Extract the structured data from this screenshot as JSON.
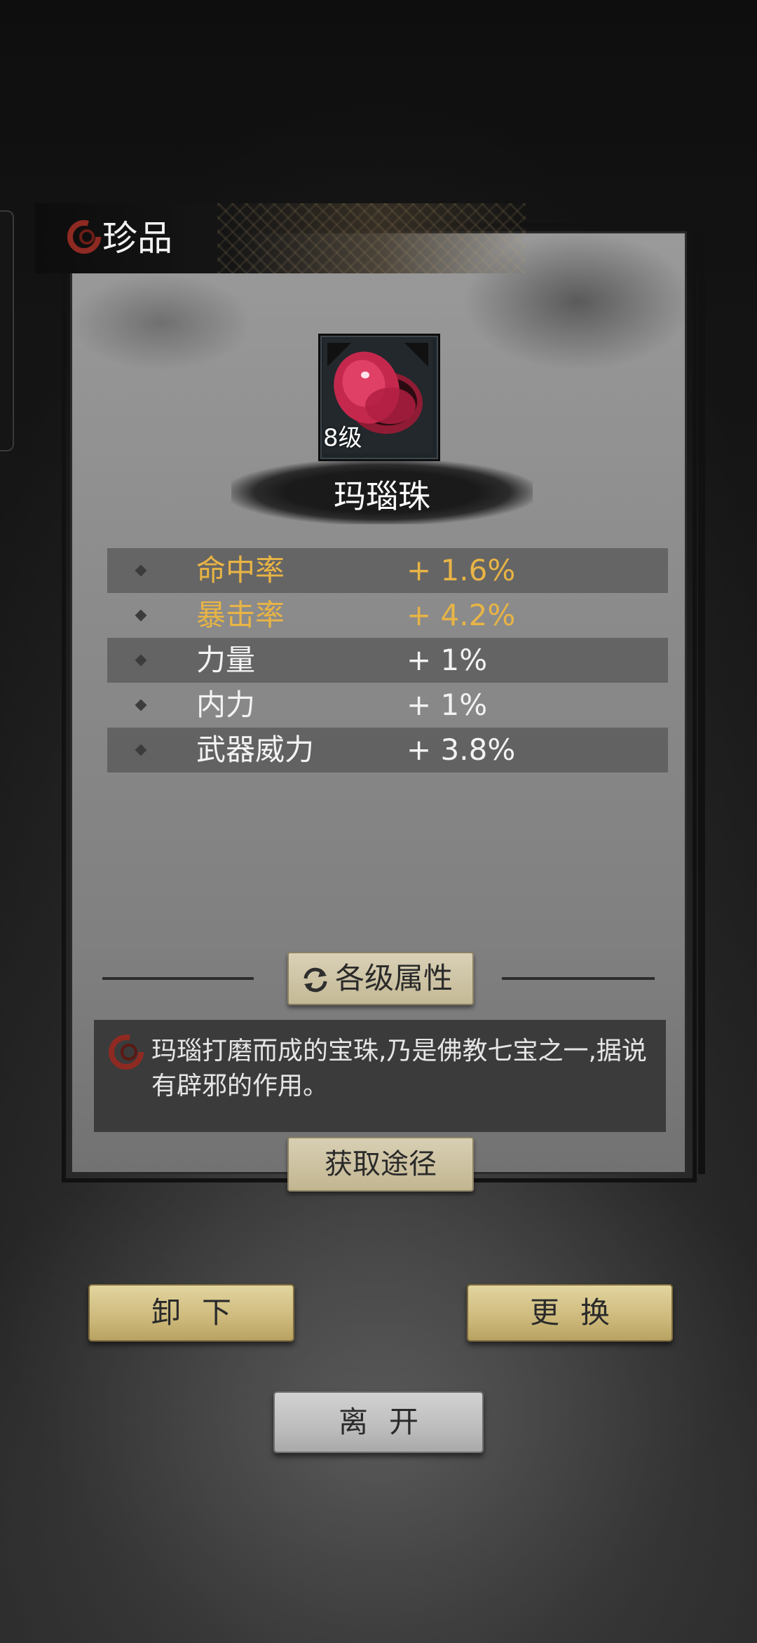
{
  "panel": {
    "title": "珍品"
  },
  "item": {
    "level": "8级",
    "name": "玛瑙珠",
    "icon": "red-agate-bead"
  },
  "stats": [
    {
      "label": "命中率",
      "value": "+ 1.6%",
      "color": "#e8b445"
    },
    {
      "label": "暴击率",
      "value": "+ 4.2%",
      "color": "#e8b445"
    },
    {
      "label": "力量",
      "value": "+ 1%",
      "color": "#f3f3f3"
    },
    {
      "label": "内力",
      "value": "+ 1%",
      "color": "#f3f3f3"
    },
    {
      "label": "武器威力",
      "value": "+ 3.8%",
      "color": "#f3f3f3"
    }
  ],
  "tier_button": {
    "label": "各级属性",
    "icon": "refresh-icon"
  },
  "description": "玛瑙打磨而成的宝珠,乃是佛教七宝之一,据说有辟邪的作用。",
  "source_button": {
    "label": "获取途径"
  },
  "actions": {
    "unequip": "卸下",
    "replace": "更换",
    "leave": "离开"
  }
}
